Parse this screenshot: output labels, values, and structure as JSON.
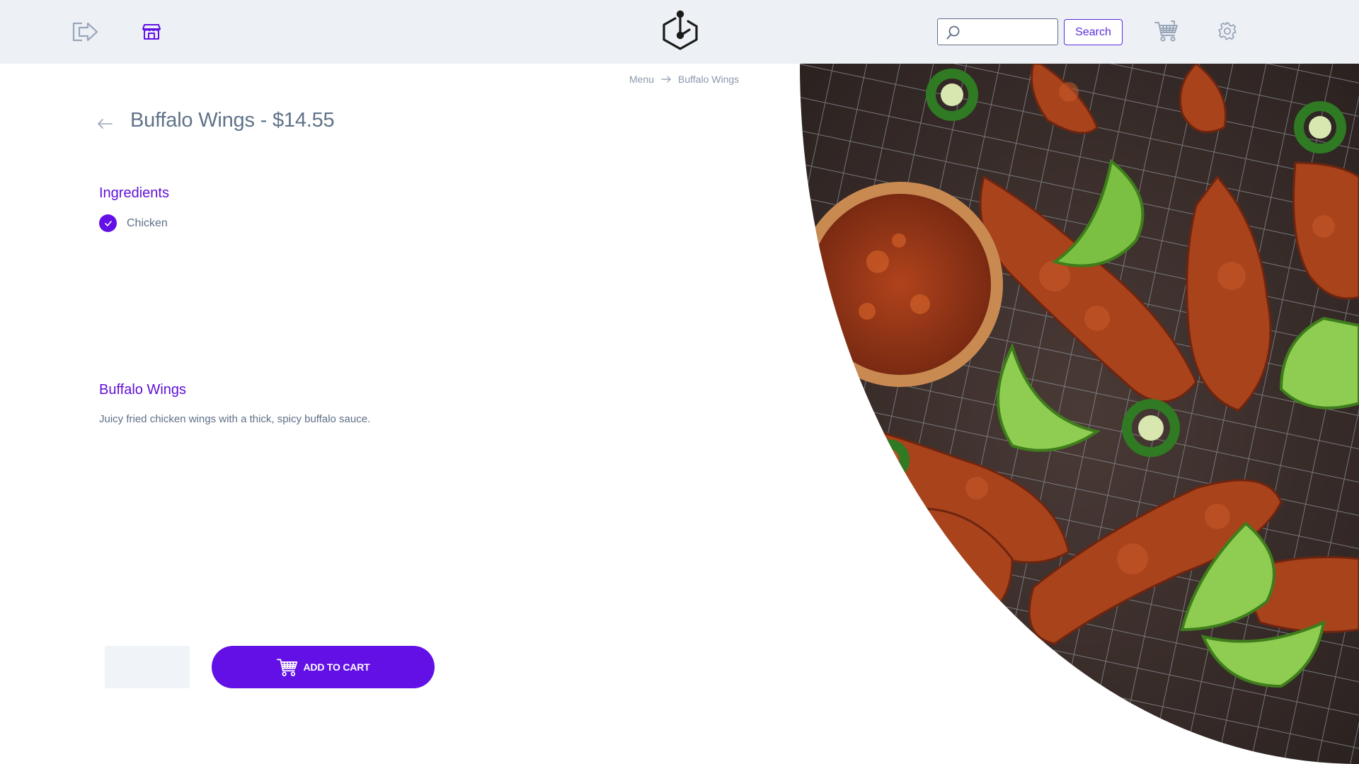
{
  "header": {
    "search_placeholder": "",
    "search_button_label": "Search"
  },
  "breadcrumb": {
    "items": [
      "Menu",
      "Buffalo Wings"
    ]
  },
  "product": {
    "title": "Buffalo Wings - $14.55",
    "ingredients_heading": "Ingredients",
    "ingredients": [
      "Chicken"
    ],
    "description_heading": "Buffalo Wings",
    "description": "Juicy fried chicken wings with a thick, spicy buffalo sauce."
  },
  "cart": {
    "quantity_value": "",
    "add_to_cart_label": "ADD TO CART"
  },
  "colors": {
    "accent": "#6210e6",
    "topbar_bg": "#edf1f6",
    "text": "#5f6f87"
  }
}
